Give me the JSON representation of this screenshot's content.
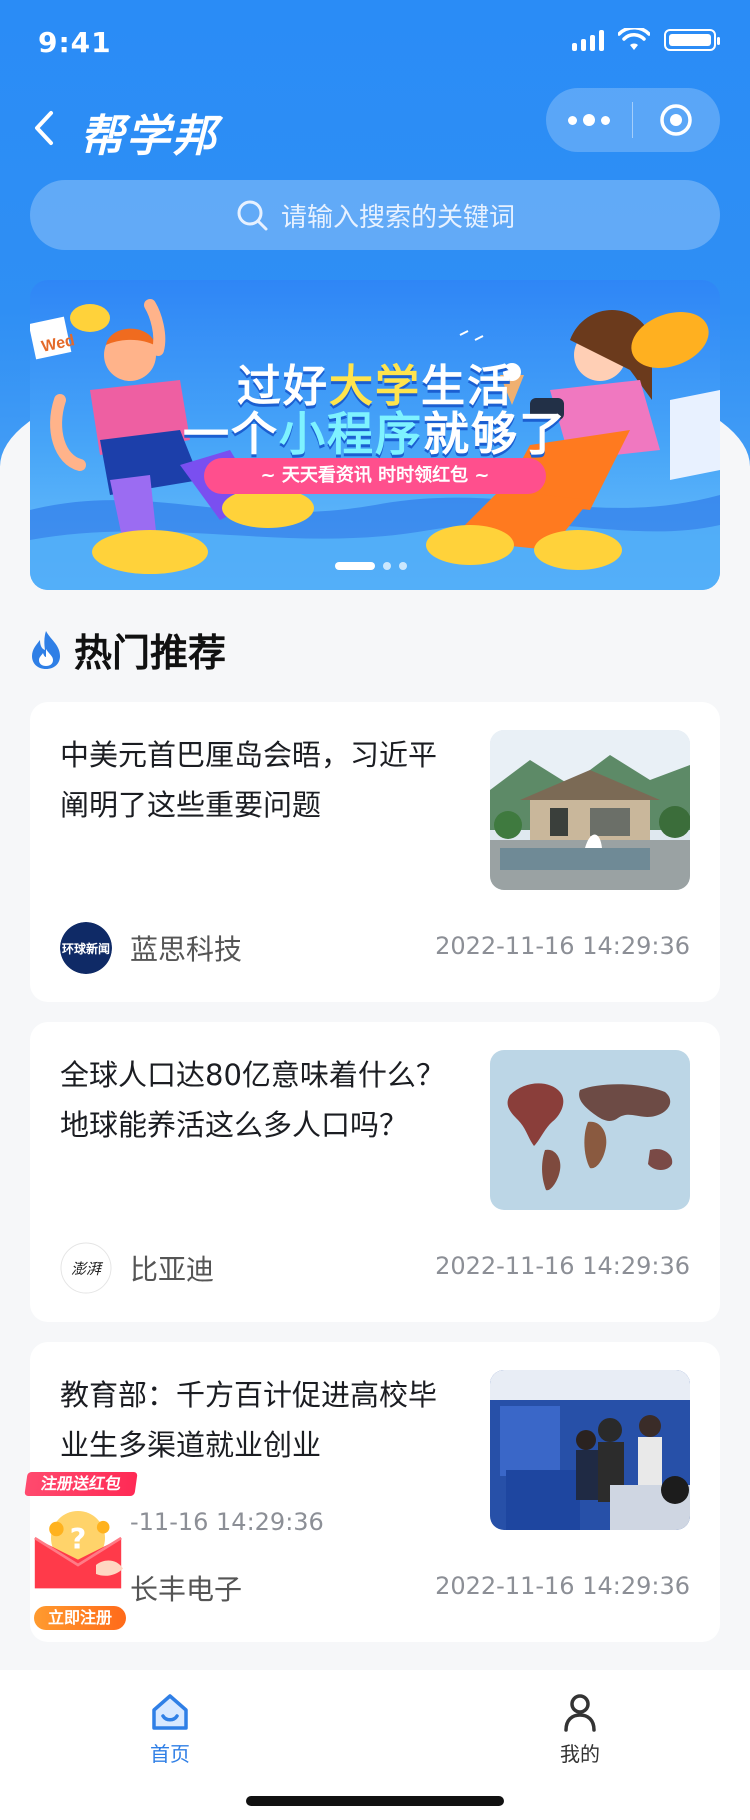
{
  "status": {
    "time": "9:41"
  },
  "header": {
    "brand": "帮学邦"
  },
  "search": {
    "placeholder": "请输入搜索的关键词"
  },
  "banner": {
    "line1_pre": "过好",
    "line1_hl": "大学",
    "line1_post": "生活",
    "line2_pre": "一个",
    "line2_hl": "小程序",
    "line2_post": "就够了",
    "pill": "~ 天天看资讯 时时领红包 ~",
    "sticker": "Wed",
    "slides": 3,
    "active_slide": 1
  },
  "section": {
    "title": "热门推荐"
  },
  "articles": [
    {
      "title": "中美元首巴厘岛会晤，习近平阐明了这些重要问题",
      "author": "蓝思科技",
      "avatar_text": "环球新闻",
      "time": "2022-11-16 14:29:36"
    },
    {
      "title": "全球人口达80亿意味着什么？地球能养活这么多人口吗？",
      "author": "比亚迪",
      "avatar_text": "澎湃",
      "time": "2022-11-16 14:29:36"
    },
    {
      "title": "教育部：千方百计促进高校毕业生多渠道就业创业",
      "author": "长丰电子",
      "extra_time": "-11-16 14:29:36",
      "time": "2022-11-16 14:29:36"
    }
  ],
  "promo": {
    "top": "注册送红包",
    "button": "立即注册"
  },
  "tabbar": {
    "home": {
      "label": "首页",
      "icon": "home-icon",
      "active": true
    },
    "mine": {
      "label": "我的",
      "icon": "user-icon",
      "active": false
    }
  },
  "colors": {
    "primary": "#2f8ff4",
    "active_tab": "#2f7fe6",
    "inactive_tab": "#333333"
  }
}
